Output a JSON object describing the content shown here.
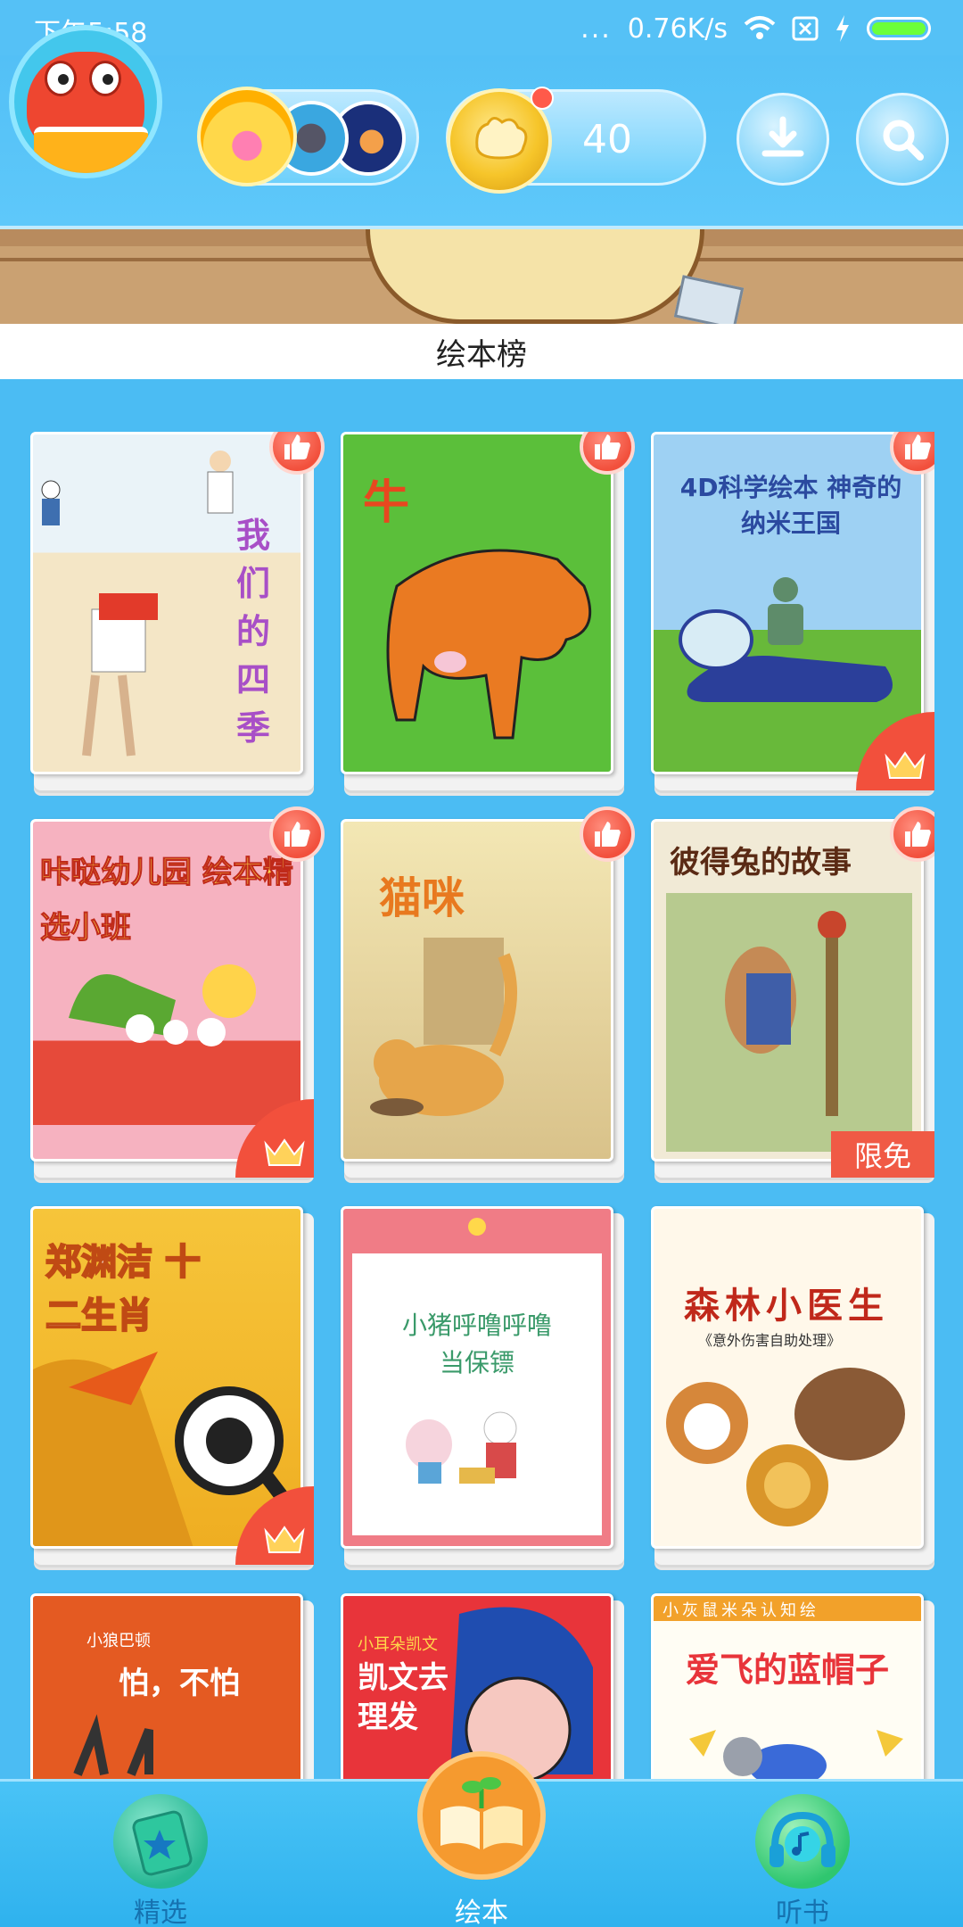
{
  "status_bar": {
    "time": "下午5:58",
    "network_speed": "0.76K/s",
    "dots": "..."
  },
  "header": {
    "coin_count": "40",
    "download_icon": "download-icon",
    "search_icon": "search-icon"
  },
  "section": {
    "title": "绘本榜"
  },
  "books": [
    {
      "title": "我们的四季",
      "badge": "like"
    },
    {
      "title": "牛",
      "badge": "like"
    },
    {
      "title": "4D科学绘本 神奇的纳米王国",
      "badge": "like",
      "vip": true
    },
    {
      "title": "咔哒幼儿园 绘本精选小班",
      "badge": "like",
      "vip": true
    },
    {
      "title": "猫咪",
      "badge": "like"
    },
    {
      "title": "彼得兔的故事",
      "badge": "like",
      "tag": "限免"
    },
    {
      "title": "郑渊洁 十二生肖",
      "vip": true
    },
    {
      "title": "小猪呼噜呼噜当保镖"
    },
    {
      "title": "森林小医生",
      "subtitle": "《意外伤害自助处理》"
    },
    {
      "title": "怕，不怕",
      "series": "小狼巴顿"
    },
    {
      "title": "凯文去理发",
      "series": "小耳朵凯文"
    },
    {
      "title": "爱飞的蓝帽子",
      "series": "小灰鼠米朵认知绘"
    }
  ],
  "bottom_nav": {
    "items": [
      {
        "label": "精选",
        "icon": "star-tag-icon"
      },
      {
        "label": "绘本",
        "icon": "open-book-sprout-icon"
      },
      {
        "label": "听书",
        "icon": "music-headphones-icon"
      }
    ]
  },
  "colors": {
    "background": "#4bbcf3",
    "accent_red": "#f2503c",
    "nav_active": "#f59a2f"
  }
}
